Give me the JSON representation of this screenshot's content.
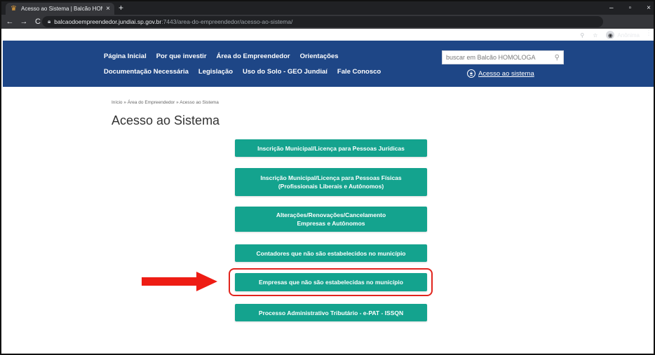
{
  "browser": {
    "tab_title": "Acesso ao Sistema | Balcão HOM",
    "tab_close": "×",
    "new_tab": "+",
    "window_controls": [
      "–",
      "▫",
      "×"
    ],
    "nav": {
      "back": "←",
      "forward": "→",
      "reload": "C"
    },
    "url_host": "balcaodoempreendedor.jundiai.sp.gov.br",
    "url_path": ":7443/area-do-empreendedor/acesso-ao-sistema/",
    "profile_label": "Anônima",
    "menu": "⋮",
    "icons": [
      "favicon-icon",
      "lock-icon",
      "zoom-icon",
      "star-icon",
      "incognito-icon",
      "menu-icon"
    ]
  },
  "header": {
    "nav_row1": [
      "Página Inicial",
      "Por que investir",
      "Área do Empreendedor",
      "Orientações"
    ],
    "nav_row2": [
      "Documentação Necessária",
      "Legislação",
      "Uso do Solo - GEO Jundiaí",
      "Fale Conosco"
    ],
    "search_placeholder": "buscar em Balcão HOMOLOGA",
    "access_label": "Acesso ao sistema"
  },
  "page": {
    "breadcrumb": "Início » Área do Empreendedor » Acesso ao Sistema",
    "title": "Acesso ao Sistema",
    "buttons": [
      {
        "line1": "Inscrição Municipal/Licença para Pessoas Jurídicas",
        "line2": ""
      },
      {
        "line1": "Inscrição Municipal/Licença para Pessoas Físicas",
        "line2": "(Profissionais Liberais e Autônomos)"
      },
      {
        "line1": "Alterações/Renovações/Cancelamento",
        "line2": "Empresas e Autônomos"
      },
      {
        "line1": "Contadores que não são estabelecidos no município",
        "line2": ""
      },
      {
        "line1": "Empresas que não são estabelecidas no município",
        "line2": ""
      },
      {
        "line1": "Processo Administrativo Tributário - e-PAT - ISSQN",
        "line2": ""
      }
    ],
    "highlighted_button_index": 4
  },
  "colors": {
    "header_bg": "#1e4686",
    "button_bg": "#14a38e",
    "highlight": "#e1241d",
    "arrow": "#ee1c14"
  }
}
